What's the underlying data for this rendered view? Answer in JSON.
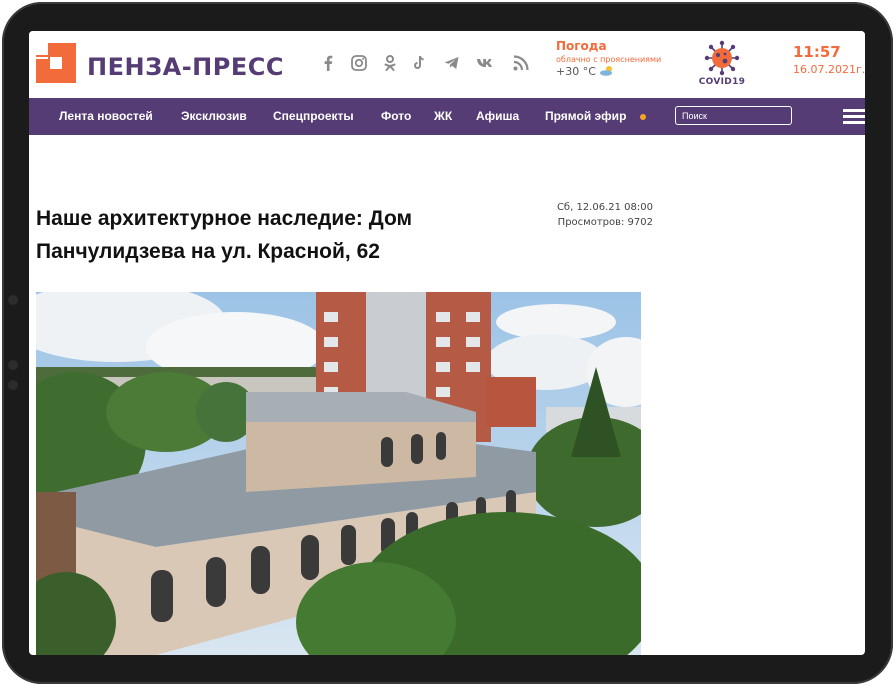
{
  "site": {
    "name": "ПЕНЗА-ПРЕСС",
    "brand_color": "#553c74",
    "accent_color": "#f26b3a"
  },
  "social_icons": [
    "facebook-icon",
    "instagram-icon",
    "odnoklassniki-icon",
    "tiktok-icon",
    "telegram-icon",
    "vk-icon",
    "rss-icon"
  ],
  "weather": {
    "title": "Погода",
    "subtitle": "облачно с прояснениями",
    "temp": "+30 °С"
  },
  "covid": {
    "label": "COVID19"
  },
  "clock": {
    "time": "11:57",
    "date": "16.07.2021г."
  },
  "nav": {
    "items": [
      "Лента новостей",
      "Эксклюзив",
      "Спецпроекты",
      "Фото",
      "ЖК",
      "Афиша",
      "Прямой эфир"
    ],
    "search_placeholder": "Поиск"
  },
  "article": {
    "title": "Наше архитектурное наследие: Дом Панчулидзева на ул. Красной, 62",
    "date": "Сб, 12.06.21 08:00",
    "views": "Просмотров: 9702"
  }
}
